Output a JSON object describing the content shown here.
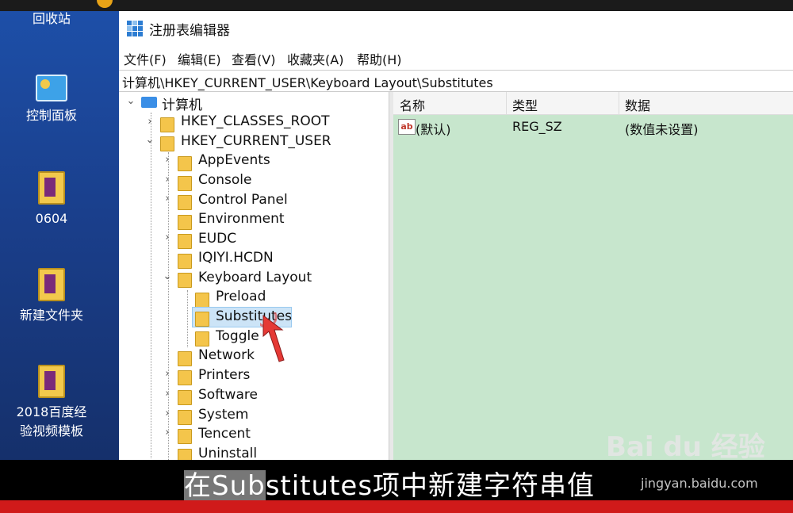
{
  "desktop": {
    "icons": [
      {
        "label": "回收站"
      },
      {
        "label": "控制面板"
      },
      {
        "label": "0604"
      },
      {
        "label": "新建文件夹"
      },
      {
        "label1": "2018百度经",
        "label2": "验视频模板"
      }
    ]
  },
  "window": {
    "title": "注册表编辑器",
    "menu": [
      "文件(F)",
      "编辑(E)",
      "查看(V)",
      "收藏夹(A)",
      "帮助(H)"
    ],
    "address": "计算机\\HKEY_CURRENT_USER\\Keyboard Layout\\Substitutes"
  },
  "tree": {
    "root": "计算机",
    "hives": [
      "HKEY_CLASSES_ROOT",
      "HKEY_CURRENT_USER"
    ],
    "hkcu_children": [
      "AppEvents",
      "Console",
      "Control Panel",
      "Environment",
      "EUDC",
      "IQIYI.HCDN",
      "Keyboard Layout"
    ],
    "keyboard_layout_children": [
      "Preload",
      "Substitutes",
      "Toggle"
    ],
    "after": [
      "Network",
      "Printers",
      "Software",
      "System",
      "Tencent",
      "Uninstall"
    ],
    "selected": "Substitutes"
  },
  "values_pane": {
    "headers": {
      "name": "名称",
      "type": "类型",
      "data": "数据"
    },
    "rows": [
      {
        "icon": "ab",
        "name": "(默认)",
        "type": "REG_SZ",
        "data": "(数值未设置)"
      }
    ],
    "background": "#c7e6cd"
  },
  "caption": {
    "highlight": "在Sub",
    "rest": "stitutes项中新建字符串值"
  },
  "watermark": {
    "logo": "Bai du 经验",
    "url": "jingyan.baidu.com"
  }
}
